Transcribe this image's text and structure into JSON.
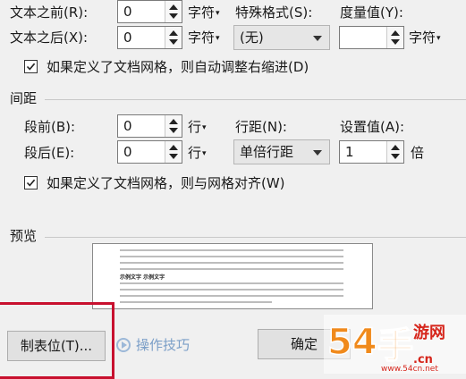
{
  "indent": {
    "before_label": "文本之前(R):",
    "before_value": "0",
    "before_unit": "字符",
    "after_label": "文本之后(X):",
    "after_value": "0",
    "after_unit": "字符",
    "special_label": "特殊格式(S):",
    "special_value": "(无)",
    "measure_label": "度量值(Y):",
    "measure_value": "",
    "measure_unit": "字符",
    "auto_adjust_label": "如果定义了文档网格，则自动调整右缩进(D)",
    "auto_adjust_checked": true
  },
  "spacing": {
    "section_title": "间距",
    "before_label": "段前(B):",
    "before_value": "0",
    "before_unit": "行",
    "after_label": "段后(E):",
    "after_value": "0",
    "after_unit": "行",
    "line_spacing_label": "行距(N):",
    "line_spacing_value": "单倍行距",
    "setting_label": "设置值(A):",
    "setting_value": "1",
    "setting_unit": "倍",
    "snap_grid_label": "如果定义了文档网格，则与网格对齐(W)",
    "snap_grid_checked": true
  },
  "preview": {
    "section_title": "预览",
    "sample_text": "示例文字 示例文字"
  },
  "footer": {
    "tabs_button": "制表位(T)...",
    "tips_link": "操作技巧",
    "ok_button": "确定"
  },
  "watermark": {
    "text": "54手游网",
    "url": "www.54cn.net"
  },
  "colors": {
    "highlight_box": "#c8102e",
    "watermark_orange": "#f08a1c",
    "watermark_red": "#d6261c"
  }
}
